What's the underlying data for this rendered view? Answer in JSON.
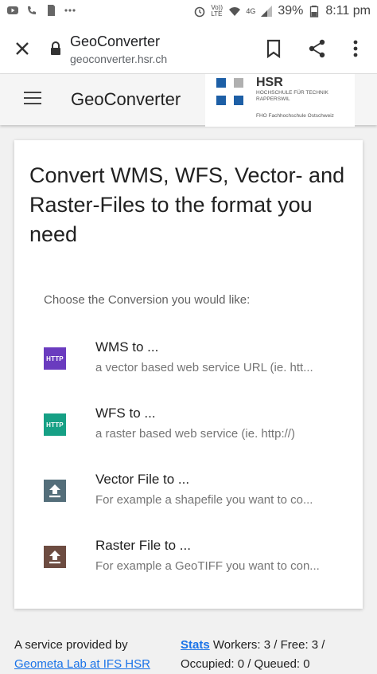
{
  "status_bar": {
    "network_label": "Vo)) LTE",
    "signal_label": "4G",
    "battery": "39%",
    "time": "8:11 pm"
  },
  "browser": {
    "title": "GeoConverter",
    "url": "geoconverter.hsr.ch"
  },
  "app_header": {
    "title": "GeoConverter",
    "logo": {
      "name": "HSR",
      "subtitle": "HOCHSCHULE FÜR TECHNIK RAPPERSWIL",
      "fho": "FHO Fachhochschule Ostschweiz",
      "colors": [
        "#1d5fa6",
        "#b0b0b0"
      ]
    }
  },
  "main": {
    "heading": "Convert WMS, WFS, Vector- and Raster-Files to the format you need",
    "choose_label": "Choose the Conversion you would like:",
    "items": [
      {
        "icon": "http-badge-icon",
        "badge": "HTTP",
        "color": "#6a3bbf",
        "title": "WMS to ...",
        "subtitle": "a vector based web service URL (ie. htt..."
      },
      {
        "icon": "http-badge-icon",
        "badge": "HTTP",
        "color": "#16a085",
        "title": "WFS to ...",
        "subtitle": "a raster based web service (ie. http://)"
      },
      {
        "icon": "upload-icon",
        "color": "#546e7a",
        "title": "Vector File to ...",
        "subtitle": "For example a shapefile you want to co..."
      },
      {
        "icon": "upload-icon",
        "color": "#6d4c41",
        "title": "Raster File to ...",
        "subtitle": "For example a GeoTIFF you want to con..."
      }
    ]
  },
  "footer": {
    "provided_by": "A service provided by",
    "provider_link": "Geometa Lab at IFS HSR",
    "stats_link": "Stats",
    "workers_line": " Workers: 3 / Free: 3 /",
    "occupied_line": "Occupied: 0 / Queued: 0"
  }
}
